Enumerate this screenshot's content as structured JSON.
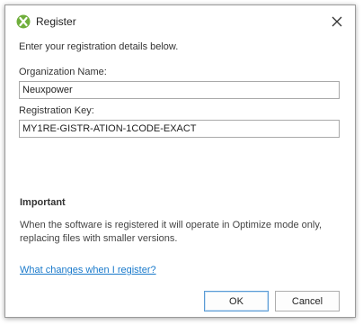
{
  "window": {
    "title": "Register",
    "app_icon": "app-logo-icon",
    "close_icon": "close-icon"
  },
  "intro_text": "Enter your registration details below.",
  "organization": {
    "label": "Organization Name:",
    "value": "Neuxpower"
  },
  "registration_key": {
    "label": "Registration Key:",
    "value": "MY1RE-GISTR-ATION-1CODE-EXACT"
  },
  "important": {
    "heading": "Important",
    "text": "When the software is registered it will operate in Optimize mode only, replacing files with smaller versions."
  },
  "help_link": "What changes when I register?",
  "buttons": {
    "ok": "OK",
    "cancel": "Cancel"
  },
  "colors": {
    "accent": "#1a7acb",
    "logo_green": "#6fae3b",
    "focus_border": "#5a9bd5"
  }
}
